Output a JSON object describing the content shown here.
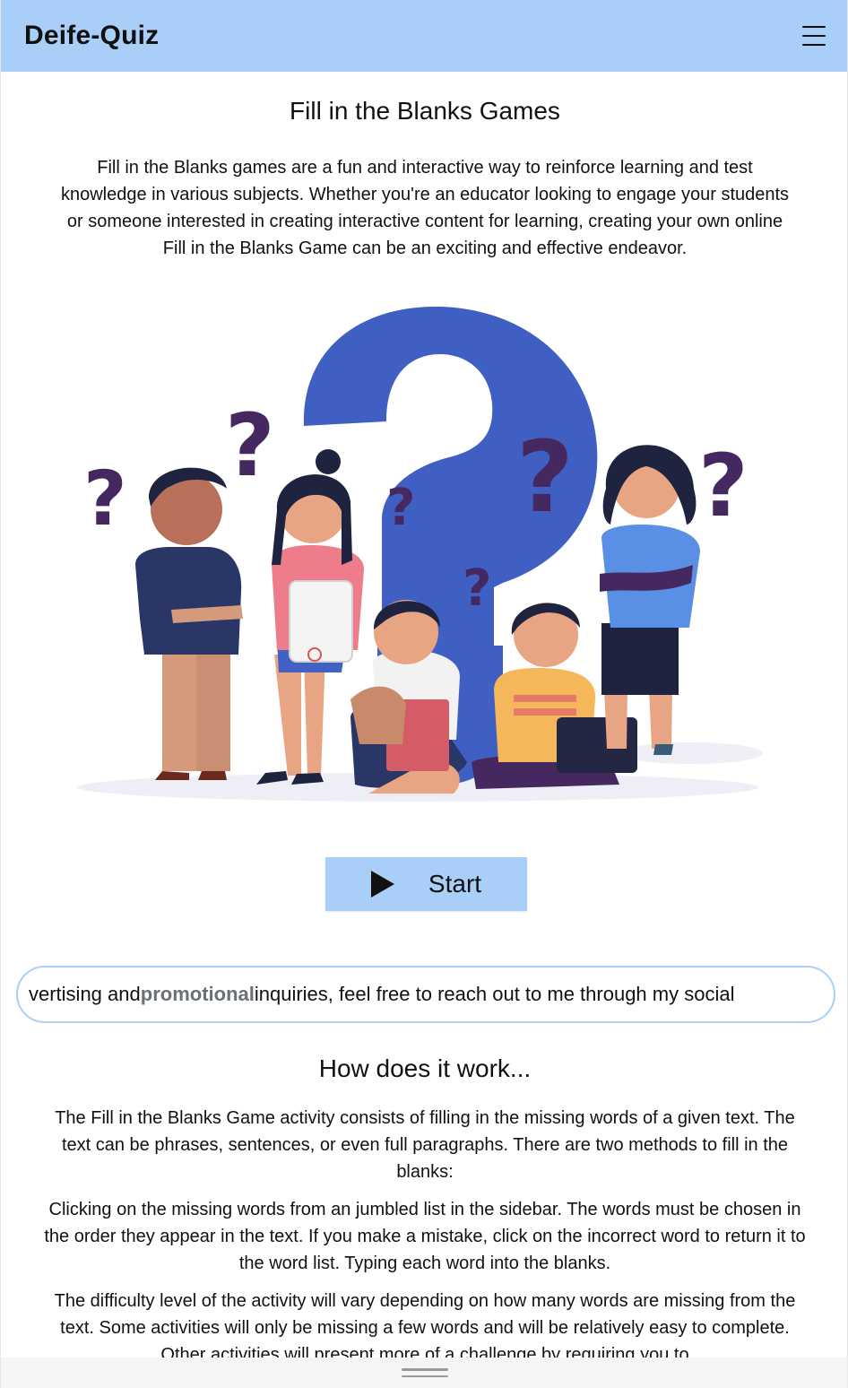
{
  "navbar": {
    "brand": "Deife-Quiz",
    "menu_icon": "hamburger-menu-icon"
  },
  "main": {
    "title": "Fill in the Blanks Games",
    "intro": "Fill in the Blanks games are a fun and interactive way to reinforce learning and test knowledge in various subjects. Whether you're an educator looking to engage your students or someone interested in creating interactive content for learning, creating your own online Fill in the Blanks Game can be an exciting and effective endeavor.",
    "start_label": "Start",
    "start_icon": "play-icon"
  },
  "marquee": {
    "before": "vertising and ",
    "highlight": "promotional",
    "after": " inquiries, feel free to reach out to me through my social"
  },
  "how": {
    "title": "How does it work...",
    "p1": "The Fill in the Blanks Game activity consists of filling in the missing words of a given text. The text can be phrases, sentences, or even full paragraphs. There are two methods to fill in the blanks:",
    "p2": "Clicking on the missing words from an jumbled list in the sidebar. The words must be chosen in the order they appear in the text. If you make a mistake, click on the incorrect word to return it to the word list. Typing each word into the blanks.",
    "p3": "The difficulty level of the activity will vary depending on how many words are missing from the text. Some activities will only be missing a few words and will be relatively easy to complete. Other activities will present more of a challenge by requiring you to"
  },
  "colors": {
    "navbar_bg": "#a9cff8",
    "question_mark_blue": "#3f5fc2",
    "question_mark_purple": "#44285f"
  }
}
